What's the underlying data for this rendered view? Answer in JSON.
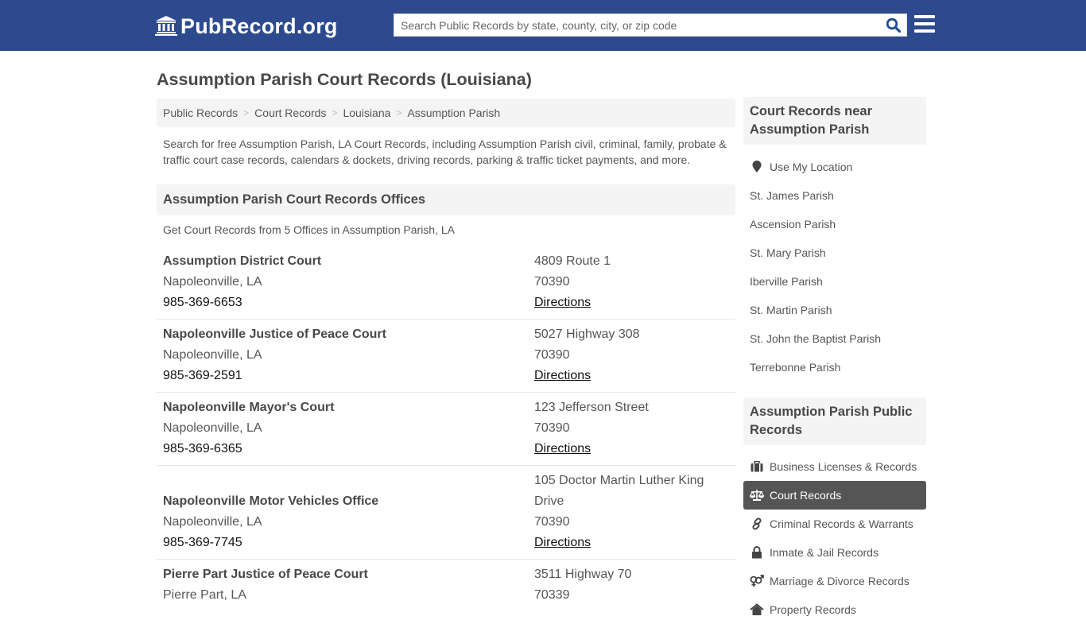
{
  "header": {
    "logo_text": "PubRecord.org",
    "search_placeholder": "Search Public Records by state, county, city, or zip code",
    "brand_color": "#2e4a8e"
  },
  "page": {
    "title": "Assumption Parish Court Records (Louisiana)",
    "breadcrumb": [
      "Public Records",
      "Court Records",
      "Louisiana",
      "Assumption Parish"
    ],
    "intro": "Search for free Assumption Parish, LA Court Records, including Assumption Parish civil, criminal, family, probate & traffic court case records, calendars & dockets, driving records, parking & traffic ticket payments, and more.",
    "section_title": "Assumption Parish Court Records Offices",
    "section_subtitle": "Get Court Records from 5 Offices in Assumption Parish, LA"
  },
  "offices": [
    {
      "name": "Assumption District Court",
      "city": "Napoleonville, LA",
      "phone": "985-369-6653",
      "address": [
        "4809 Route 1"
      ],
      "zip": "70390",
      "directions": "Directions"
    },
    {
      "name": "Napoleonville Justice of Peace Court",
      "city": "Napoleonville, LA",
      "phone": "985-369-2591",
      "address": [
        "5027 Highway 308"
      ],
      "zip": "70390",
      "directions": "Directions"
    },
    {
      "name": "Napoleonville Mayor's Court",
      "city": "Napoleonville, LA",
      "phone": "985-369-6365",
      "address": [
        "123 Jefferson Street"
      ],
      "zip": "70390",
      "directions": "Directions"
    },
    {
      "name": "Napoleonville Motor Vehicles Office",
      "city": "Napoleonville, LA",
      "phone": "985-369-7745",
      "address": [
        "105 Doctor Martin Luther King",
        "Drive"
      ],
      "zip": "70390",
      "directions": "Directions"
    },
    {
      "name": "Pierre Part Justice of Peace Court",
      "city": "Pierre Part, LA",
      "phone": "",
      "address": [
        "3511 Highway 70"
      ],
      "zip": "70339",
      "directions": ""
    }
  ],
  "sidebar": {
    "nearby_title": "Court Records near Assumption Parish",
    "use_location": "Use My Location",
    "nearby": [
      "St. James Parish",
      "Ascension Parish",
      "St. Mary Parish",
      "Iberville Parish",
      "St. Martin Parish",
      "St. John the Baptist Parish",
      "Terrebonne Parish"
    ],
    "public_title": "Assumption Parish Public Records",
    "public_records": [
      {
        "label": "Business Licenses & Records",
        "icon": "briefcase-icon",
        "active": false
      },
      {
        "label": "Court Records",
        "icon": "balance-scale-icon",
        "active": true
      },
      {
        "label": "Criminal Records & Warrants",
        "icon": "link-icon",
        "active": false
      },
      {
        "label": "Inmate & Jail Records",
        "icon": "lock-icon",
        "active": false
      },
      {
        "label": "Marriage & Divorce Records",
        "icon": "gender-symbol-icon",
        "active": false
      },
      {
        "label": "Property Records",
        "icon": "home-icon",
        "active": false
      }
    ]
  }
}
